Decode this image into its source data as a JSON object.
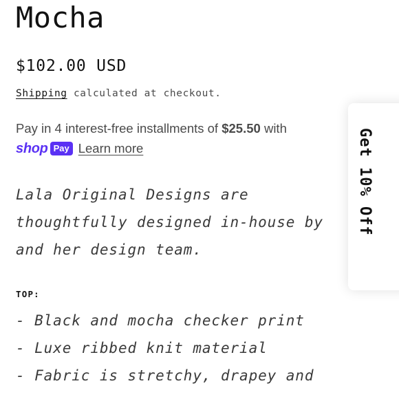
{
  "product": {
    "title": "Mocha",
    "price": "$102.00 USD"
  },
  "shipping": {
    "link_text": "Shipping",
    "rest_text": " calculated at checkout."
  },
  "installments": {
    "prefix": "Pay in 4 interest-free installments of ",
    "amount": "$25.50",
    "suffix": " with",
    "shop_word": "shop",
    "pay_badge": "Pay",
    "learn_more": "Learn more",
    "brand_color": "#5a31f4"
  },
  "description": {
    "lines": [
      "Lala Original Designs are",
      "thoughtfully designed in-house by",
      "and her design team."
    ]
  },
  "top_section": {
    "label": "TOP:",
    "features": [
      "- Black and mocha checker print",
      "- Luxe ribbed knit material",
      "- Fabric is stretchy, drapey and"
    ]
  },
  "discount_tab": {
    "label": "Get 10% Off"
  }
}
